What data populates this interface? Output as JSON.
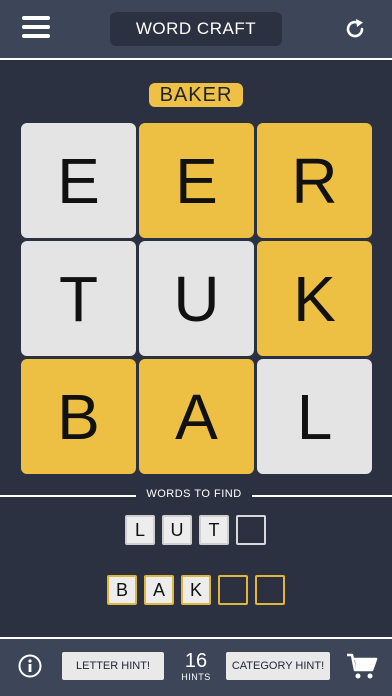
{
  "header": {
    "title": "WORD CRAFT",
    "menu_icon": "hamburger-icon",
    "refresh_icon": "refresh-icon"
  },
  "current_word": "BAKER",
  "grid": {
    "tiles": [
      {
        "letter": "E",
        "color": "gray"
      },
      {
        "letter": "E",
        "color": "yellow"
      },
      {
        "letter": "R",
        "color": "yellow"
      },
      {
        "letter": "T",
        "color": "gray"
      },
      {
        "letter": "U",
        "color": "gray"
      },
      {
        "letter": "K",
        "color": "yellow"
      },
      {
        "letter": "B",
        "color": "yellow"
      },
      {
        "letter": "A",
        "color": "yellow"
      },
      {
        "letter": "L",
        "color": "gray"
      }
    ]
  },
  "words_to_find": {
    "label": "WORDS TO FIND",
    "words": [
      {
        "letters": [
          "L",
          "U",
          "T",
          ""
        ],
        "highlight": false
      },
      {
        "letters": [
          "B",
          "A",
          "K",
          "",
          ""
        ],
        "highlight": true
      }
    ]
  },
  "footer": {
    "info_icon": "info-icon",
    "letter_hint_label": "LETTER HINT!",
    "hints_count": "16",
    "hints_label": "HINTS",
    "category_hint_label": "CATEGORY HINT!",
    "cart_icon": "cart-icon"
  },
  "colors": {
    "background": "#2b3140",
    "bar": "#3c4658",
    "yellow": "#edbf42",
    "gray": "#e4e4e4"
  }
}
